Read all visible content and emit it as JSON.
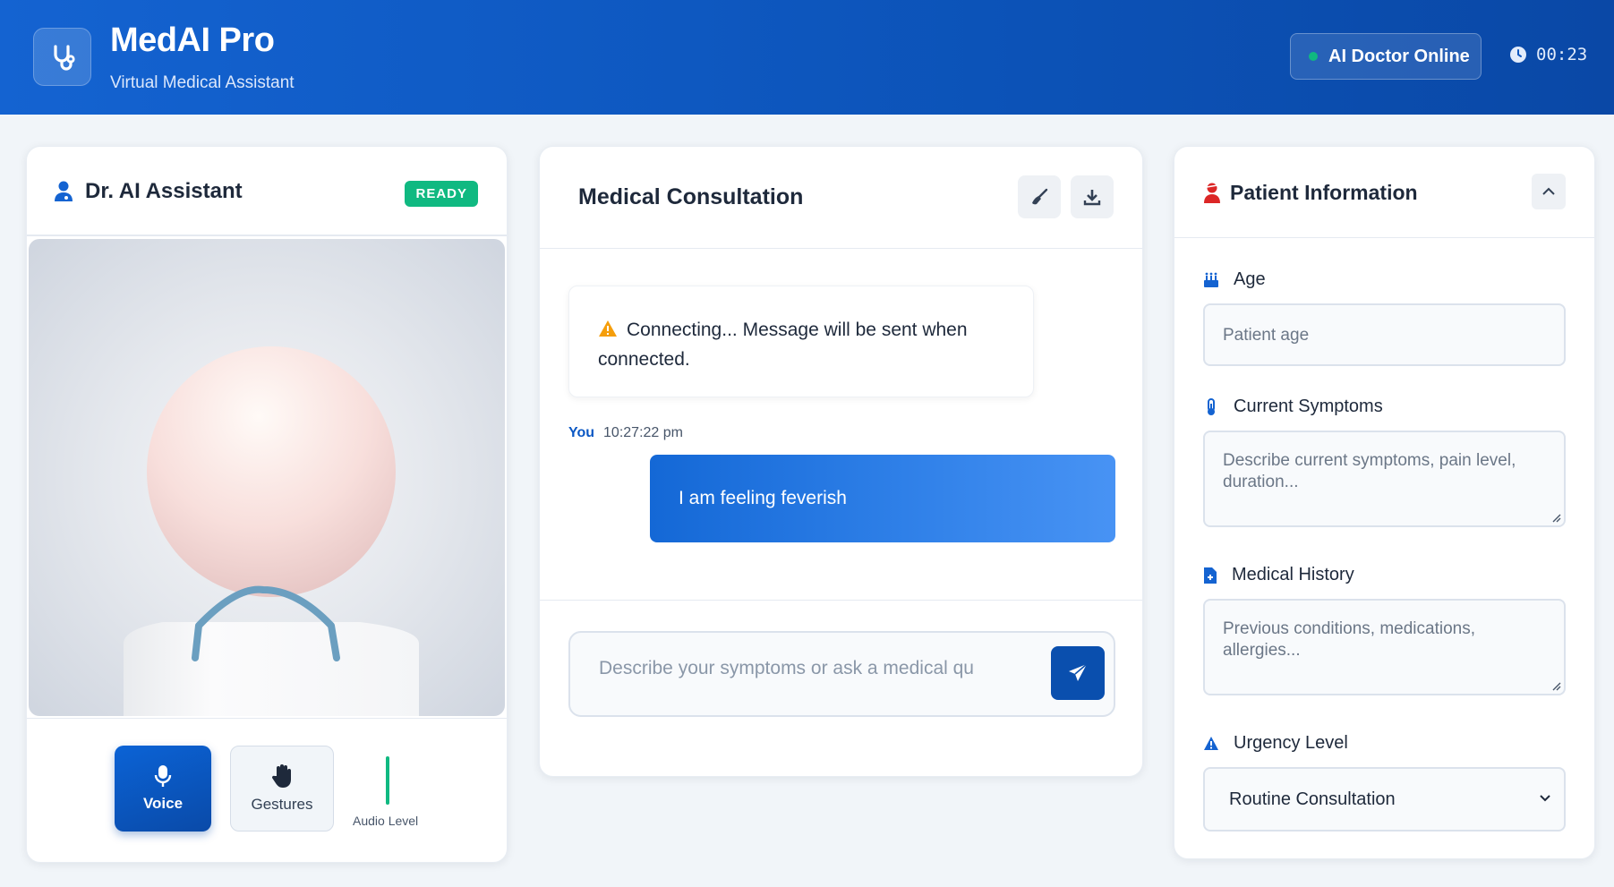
{
  "app": {
    "title": "MedAI Pro",
    "subtitle": "Virtual Medical Assistant",
    "status": "AI Doctor Online",
    "timer": "00:23",
    "logo_icon": "stethoscope-icon"
  },
  "doctor_panel": {
    "title": "Dr. AI Assistant",
    "badge": "READY",
    "voice_label": "Voice",
    "gestures_label": "Gestures",
    "audio_label": "Audio Level"
  },
  "consultation": {
    "title": "Medical Consultation",
    "system_message": "Connecting... Message will be sent when connected.",
    "messages": [
      {
        "sender": "You",
        "time": "10:27:22 pm",
        "text": "I am feeling feverish"
      }
    ],
    "input_placeholder": "Describe your symptoms or ask a medical qu"
  },
  "patient_info": {
    "title": "Patient Information",
    "age_label": "Age",
    "age_placeholder": "Patient age",
    "symptoms_label": "Current Symptoms",
    "symptoms_placeholder": "Describe current symptoms, pain level, duration...",
    "history_label": "Medical History",
    "history_placeholder": "Previous conditions, medications, allergies...",
    "urgency_label": "Urgency Level",
    "urgency_value": "Routine Consultation"
  },
  "colors": {
    "brand_blue": "#0b58c4",
    "success_green": "#10b981",
    "warning": "#f59e0b",
    "danger": "#dc2626"
  }
}
